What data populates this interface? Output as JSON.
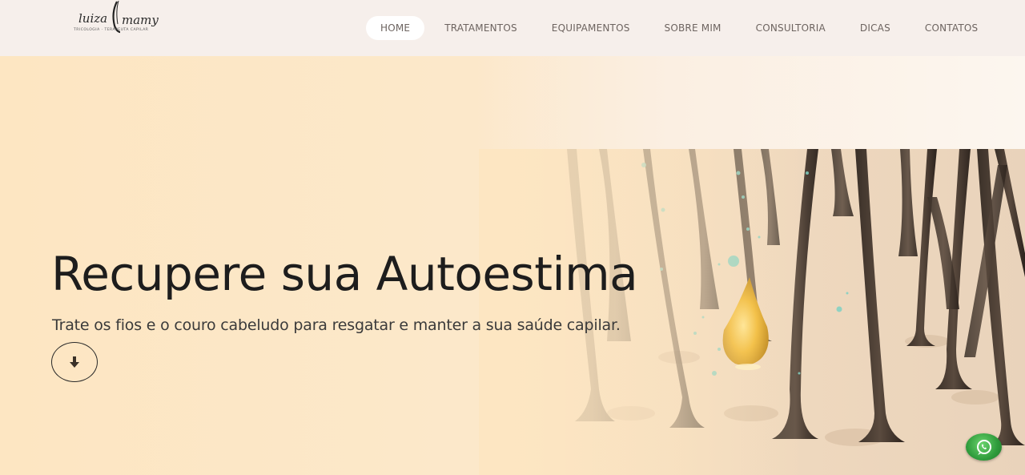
{
  "header": {
    "logo": {
      "name": "luiza mamy",
      "tagline": "TRICOLOGIA · TERAPEUTA CAPILAR"
    },
    "nav": [
      {
        "label": "HOME",
        "active": true
      },
      {
        "label": "TRATAMENTOS",
        "active": false
      },
      {
        "label": "EQUIPAMENTOS",
        "active": false
      },
      {
        "label": "SOBRE MIM",
        "active": false
      },
      {
        "label": "CONSULTORIA",
        "active": false
      },
      {
        "label": "DICAS",
        "active": false
      },
      {
        "label": "CONTATOS",
        "active": false
      }
    ]
  },
  "hero": {
    "title": "Recupere sua Autoestima",
    "subtitle": "Trate os fios e o couro cabeludo para resgatar e manter a sua saúde capilar.",
    "scroll_icon": "arrow-down-icon",
    "image": "hair-follicles-oil-drop"
  },
  "floating": {
    "whatsapp_icon": "whatsapp-icon"
  },
  "colors": {
    "header_bg": "#f6efeb",
    "hero_bg": "#fde6c2",
    "nav_text": "#6d6460",
    "title_text": "#1d1d1d",
    "whatsapp_green": "#2e9b3b"
  }
}
